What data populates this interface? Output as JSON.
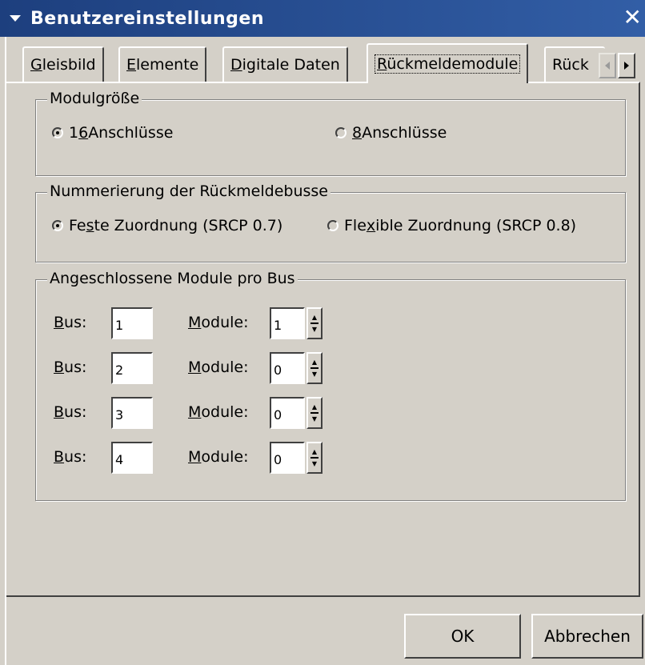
{
  "window": {
    "title": "Benutzereinstellungen",
    "close_glyph": "✕"
  },
  "tabs": [
    {
      "label": "Gleisbild",
      "mnemonic": "G",
      "rest": "leisbild"
    },
    {
      "label": "Elemente",
      "mnemonic": "E",
      "rest": "lemente"
    },
    {
      "label": "Digitale Daten",
      "mnemonic": "D",
      "rest": "igitale Daten"
    },
    {
      "label": "Rückmeldemodule",
      "mnemonic": "R",
      "rest": "ückmeldemodule",
      "active": true
    },
    {
      "label": "Rück",
      "clipped": true
    }
  ],
  "groups": {
    "module_size": {
      "title": "Modulgröße",
      "options": [
        {
          "pre": "1",
          "mnemonic": "6",
          "post": " Anschlüsse",
          "checked": true
        },
        {
          "pre": "",
          "mnemonic": "8",
          "post": " Anschlüsse",
          "checked": false
        }
      ]
    },
    "numbering": {
      "title": "Nummerierung der Rückmeldebusse",
      "options": [
        {
          "pre": "Fe",
          "mnemonic": "s",
          "post": "te Zuordnung (SRCP 0.7)",
          "checked": true
        },
        {
          "pre": "Fle",
          "mnemonic": "x",
          "post": "ible Zuordnung (SRCP 0.8)",
          "checked": false
        }
      ]
    },
    "modules_per_bus": {
      "title": "Angeschlossene Module pro Bus",
      "bus_label": {
        "mnemonic": "B",
        "rest": "us:"
      },
      "module_label": {
        "mnemonic": "M",
        "rest": "odule:"
      },
      "rows": [
        {
          "bus": "1",
          "modules": "1"
        },
        {
          "bus": "2",
          "modules": "0"
        },
        {
          "bus": "3",
          "modules": "0"
        },
        {
          "bus": "4",
          "modules": "0"
        }
      ]
    }
  },
  "buttons": {
    "ok": "OK",
    "cancel": "Abbrechen"
  }
}
